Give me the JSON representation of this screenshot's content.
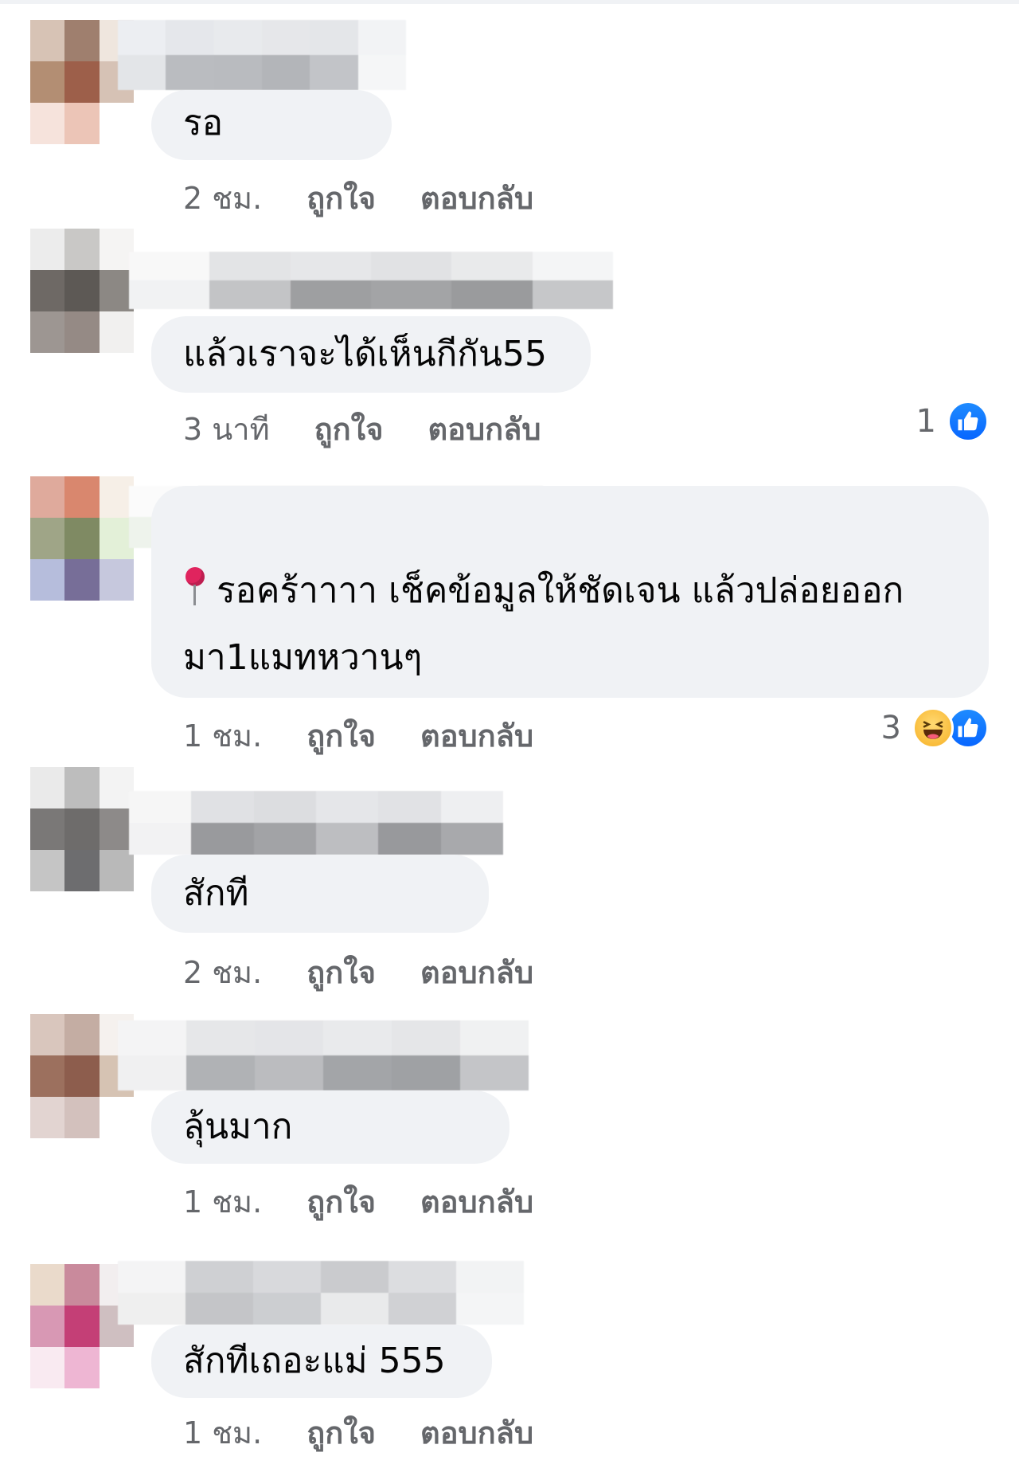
{
  "comments": [
    {
      "avatar_colors": [
        "#d7c3b5",
        "#9f7f6e",
        "#efe6de",
        "#b38e73",
        "#9d5f4a",
        "#d6c2b5",
        "#f6e3dc",
        "#ecc5b7",
        "#ffffff"
      ],
      "name_colors_top": [
        "#eceef2",
        "#e5e7eb",
        "#e8eaed",
        "#e6e7ea",
        "#e4e6e9",
        "#f2f3f5"
      ],
      "name_colors_bottom": [
        "#e3e5e8",
        "#babcc0",
        "#b9bbbf",
        "#b3b5b9",
        "#c2c4c8",
        "#f5f6f7"
      ],
      "text": "รอ",
      "time": "2 ชม.",
      "like_label": "ถูกใจ",
      "reply_label": "ตอบกลับ",
      "reaction_count": "",
      "reactions": []
    },
    {
      "avatar_colors": [
        "#ececec",
        "#c9c8c6",
        "#f5f4f3",
        "#6e6965",
        "#5d5955",
        "#8c8884",
        "#9d9692",
        "#958a85",
        "#f1f0ef"
      ],
      "name_colors_top": [
        "#f8f8f8",
        "#e3e4e6",
        "#e6e7e9",
        "#e1e2e4",
        "#e9eaeb",
        "#f4f5f6"
      ],
      "name_colors_bottom": [
        "#f1f2f3",
        "#c3c4c6",
        "#9e9fa1",
        "#a3a4a6",
        "#9a9b9d",
        "#c6c7c9"
      ],
      "text": "แล้วเราจะได้เห็นกีกัน55",
      "time": "3 นาที",
      "like_label": "ถูกใจ",
      "reply_label": "ตอบกลับ",
      "reaction_count": "1",
      "reactions": [
        "like-icon"
      ]
    },
    {
      "avatar_colors": [
        "#dfaa9c",
        "#d9876e",
        "#f6efe7",
        "#9fa587",
        "#7f8a63",
        "#e3f0d8",
        "#b6bddc",
        "#776e98",
        "#c6c8dd"
      ],
      "name_colors_top": [
        "#fbfbfb",
        "#e3e5e8",
        "#e6e7ea",
        "#e5e6e9",
        "#e3e4e7",
        "#e6e7ea"
      ],
      "name_colors_bottom": [
        "#eef3ec",
        "#c0c2c6",
        "#b7b9bd",
        "#c1c3c7",
        "#a8aaae",
        "#9d9fa3"
      ],
      "text": "รอคร้าาาา เช็คข้อมูลให้ชัดเจน แล้วปล่อยออกมา1แมทหวานๆ",
      "time": "1 ชม.",
      "like_label": "ถูกใจ",
      "reply_label": "ตอบกลับ",
      "reaction_count": "3",
      "reactions": [
        "haha-icon",
        "like-icon"
      ]
    },
    {
      "avatar_colors": [
        "#eaeaea",
        "#bdbdbd",
        "#f3f3f3",
        "#7a7877",
        "#6e6c6b",
        "#8d8a89",
        "#c5c5c5",
        "#6d6d6f",
        "#b9b9b9"
      ],
      "name_colors_top": [
        "#f6f6f6",
        "#e0e1e4",
        "#dcdde0",
        "#e5e6e9",
        "#e1e2e5",
        "#eeeff1"
      ],
      "name_colors_bottom": [
        "#f2f2f3",
        "#999a9d",
        "#a2a3a6",
        "#bdbec1",
        "#98999c",
        "#a8a9ac"
      ],
      "text": "สักที",
      "time": "2 ชม.",
      "like_label": "ถูกใจ",
      "reply_label": "ตอบกลับ",
      "reaction_count": "",
      "reactions": []
    },
    {
      "avatar_colors": [
        "#d9c6bd",
        "#c4ada3",
        "#f5f1ee",
        "#9c705e",
        "#8d5d4d",
        "#d6c3b3",
        "#e2d4d1",
        "#d3c1bd",
        "#ffffff"
      ],
      "name_colors_top": [
        "#f4f4f5",
        "#e6e7e9",
        "#e4e5e8",
        "#e9eaec",
        "#e5e6e8",
        "#f0f1f2"
      ],
      "name_colors_bottom": [
        "#f0f0f1",
        "#b0b2b5",
        "#bbbcbf",
        "#a3a5a8",
        "#9fa1a4",
        "#c4c5c8"
      ],
      "text": "ลุ้นมาก",
      "time": "1 ชม.",
      "like_label": "ถูกใจ",
      "reply_label": "ตอบกลับ",
      "reaction_count": "",
      "reactions": []
    },
    {
      "avatar_colors": [
        "#eadacb",
        "#c98a9c",
        "#f2eeef",
        "#d898b4",
        "#c43f76",
        "#cfbfc1",
        "#f9eaf1",
        "#eeb6d3",
        "#ffffff"
      ],
      "name_colors_top": [
        "#f4f4f5",
        "#cfd0d3",
        "#d8d9dc",
        "#cacbce",
        "#dcdde0",
        "#f2f3f4"
      ],
      "name_colors_bottom": [
        "#efefef",
        "#c4c5c8",
        "#ccced1",
        "#e9eaeb",
        "#d0d1d4",
        "#f4f5f6"
      ],
      "text": "สักทีเถอะแม่ 555",
      "time": "1 ชม.",
      "like_label": "ถูกใจ",
      "reply_label": "ตอบกลับ",
      "reaction_count": "",
      "reactions": []
    }
  ]
}
